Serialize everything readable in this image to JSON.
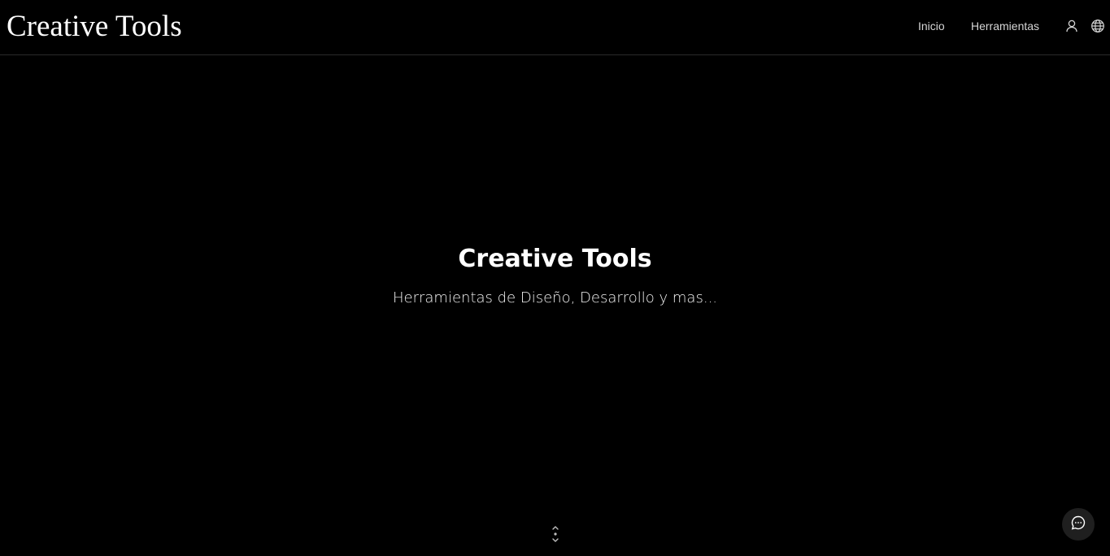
{
  "header": {
    "logo": "Creative Tools",
    "nav": [
      {
        "label": "Inicio"
      },
      {
        "label": "Herramientas"
      }
    ],
    "icons": {
      "user": "user-icon",
      "language": "globe-icon"
    }
  },
  "hero": {
    "title": "Creative Tools",
    "subtitle": "Herramientas de Diseño, Desarrollo y mas..."
  },
  "widgets": {
    "scroll": "scroll-down-icon",
    "chat": "chat-icon"
  },
  "colors": {
    "background": "#000000",
    "text": "#ffffff",
    "nav_text": "#d6d6d6",
    "chat_bg": "#1f1f1f"
  }
}
